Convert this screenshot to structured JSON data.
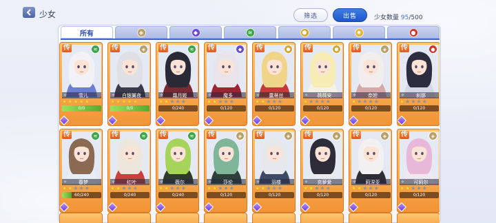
{
  "header": {
    "title": "少女",
    "filter_label": "筛选",
    "sell_label": "出售",
    "count_label": "少女数量",
    "count_current": "95",
    "count_total": "/500"
  },
  "tabs": [
    {
      "label": "所有",
      "icon": "all",
      "color": ""
    },
    {
      "label": "",
      "icon": "neutral-element-icon",
      "color": "#b9a06a"
    },
    {
      "label": "",
      "icon": "dark-element-icon",
      "color": "#6a4bd0"
    },
    {
      "label": "",
      "icon": "wind-element-icon",
      "color": "#3ea54a"
    },
    {
      "label": "",
      "icon": "earth-element-icon",
      "color": "#d7a62b"
    },
    {
      "label": "",
      "icon": "light-element-icon",
      "color": "#e8b43a"
    },
    {
      "label": "",
      "icon": "fire-element-icon",
      "color": "#d0342c"
    }
  ],
  "cards": [
    {
      "name": "雪儿",
      "rarity": "传",
      "element": "wind-element-icon",
      "element_color": "#3ea54a",
      "stars": 5,
      "level_text": "0/0",
      "level_fill": 1.0,
      "hair": "#f2f2f6",
      "outfit": "#6d7fd2"
    },
    {
      "name": "白银翼夜",
      "rarity": "传",
      "element": "neutral-element-icon",
      "element_color": "#b9a06a",
      "stars": 5,
      "level_text": "0/0",
      "level_fill": 1.0,
      "hair": "#dfe0e6",
      "outfit": "#3a3a48"
    },
    {
      "name": "霜月姬",
      "rarity": "传",
      "element": "wind-element-icon",
      "element_color": "#3ea54a",
      "stars": 2,
      "level_text": "0/240",
      "level_fill": 0.0,
      "hair": "#2a2a36",
      "outfit": "#7a2a30"
    },
    {
      "name": "魔多",
      "rarity": "传",
      "element": "dark-element-icon",
      "element_color": "#6a4bd0",
      "stars": 2,
      "level_text": "0/120",
      "level_fill": 0.0,
      "hair": "#e9e4ea",
      "outfit": "#9a2530"
    },
    {
      "name": "露蒂丝",
      "rarity": "传",
      "element": "earth-element-icon",
      "element_color": "#d7a62b",
      "stars": 2,
      "level_text": "0/120",
      "level_fill": 0.0,
      "hair": "#f0d488",
      "outfit": "#c23a3a"
    },
    {
      "name": "薇薇安",
      "rarity": "传",
      "element": "earth-element-icon",
      "element_color": "#d7a62b",
      "stars": 1,
      "level_text": "0/120",
      "level_fill": 0.0,
      "hair": "#f6ecb4",
      "outfit": "#f4f2e8"
    },
    {
      "name": "奈妲",
      "rarity": "传",
      "element": "neutral-element-icon",
      "element_color": "#b9a06a",
      "stars": 1,
      "level_text": "0/120",
      "level_fill": 0.0,
      "hair": "#f3eeee",
      "outfit": "#d6a8a8"
    },
    {
      "name": "刹那",
      "rarity": "传",
      "element": "fire-element-icon",
      "element_color": "#d0342c",
      "stars": 1,
      "level_text": "0/120",
      "level_fill": 0.0,
      "hair": "#2c2d3e",
      "outfit": "#d5d8e4"
    },
    {
      "name": "春梦",
      "rarity": "传",
      "element": "wind-element-icon",
      "element_color": "#3ea54a",
      "stars": 2,
      "level_text": "60/240",
      "level_fill": 0.25,
      "hair": "#8a6a52",
      "outfit": "#e8eef6"
    },
    {
      "name": "红叶",
      "rarity": "传",
      "element": "wind-element-icon",
      "element_color": "#3ea54a",
      "stars": 2,
      "level_text": "0/240",
      "level_fill": 0.0,
      "hair": "#ece6dc",
      "outfit": "#c9403c"
    },
    {
      "name": "薇尔",
      "rarity": "传",
      "element": "wind-element-icon",
      "element_color": "#3ea54a",
      "stars": 2,
      "level_text": "0/240",
      "level_fill": 0.0,
      "hair": "#a6d45a",
      "outfit": "#2f3a2a"
    },
    {
      "name": "莎伦",
      "rarity": "传",
      "element": "neutral-element-icon",
      "element_color": "#b9a06a",
      "stars": 2,
      "level_text": "0/120",
      "level_fill": 0.0,
      "hair": "#7fb69a",
      "outfit": "#2e3f3a"
    },
    {
      "name": "羽楼",
      "rarity": "传",
      "element": "neutral-element-icon",
      "element_color": "#b9a06a",
      "stars": 2,
      "level_text": "0/120",
      "level_fill": 0.0,
      "hair": "#e6e8ec",
      "outfit": "#3c4a66"
    },
    {
      "name": "克萝爱",
      "rarity": "传",
      "element": "neutral-element-icon",
      "element_color": "#b9a06a",
      "stars": 2,
      "level_text": "0/120",
      "level_fill": 0.0,
      "hair": "#2e2c38",
      "outfit": "#e8eaf0"
    },
    {
      "name": "莉涅亚",
      "rarity": "传",
      "element": "neutral-element-icon",
      "element_color": "#b9a06a",
      "stars": 2,
      "level_text": "0/120",
      "level_fill": 0.0,
      "hair": "#f2f0f0",
      "outfit": "#2e2c34"
    },
    {
      "name": "可莉尔",
      "rarity": "传",
      "element": "neutral-element-icon",
      "element_color": "#b9a06a",
      "stars": 2,
      "level_text": "0/120",
      "level_fill": 0.0,
      "hair": "#e7b8d8",
      "outfit": "#f0e8f0"
    }
  ]
}
